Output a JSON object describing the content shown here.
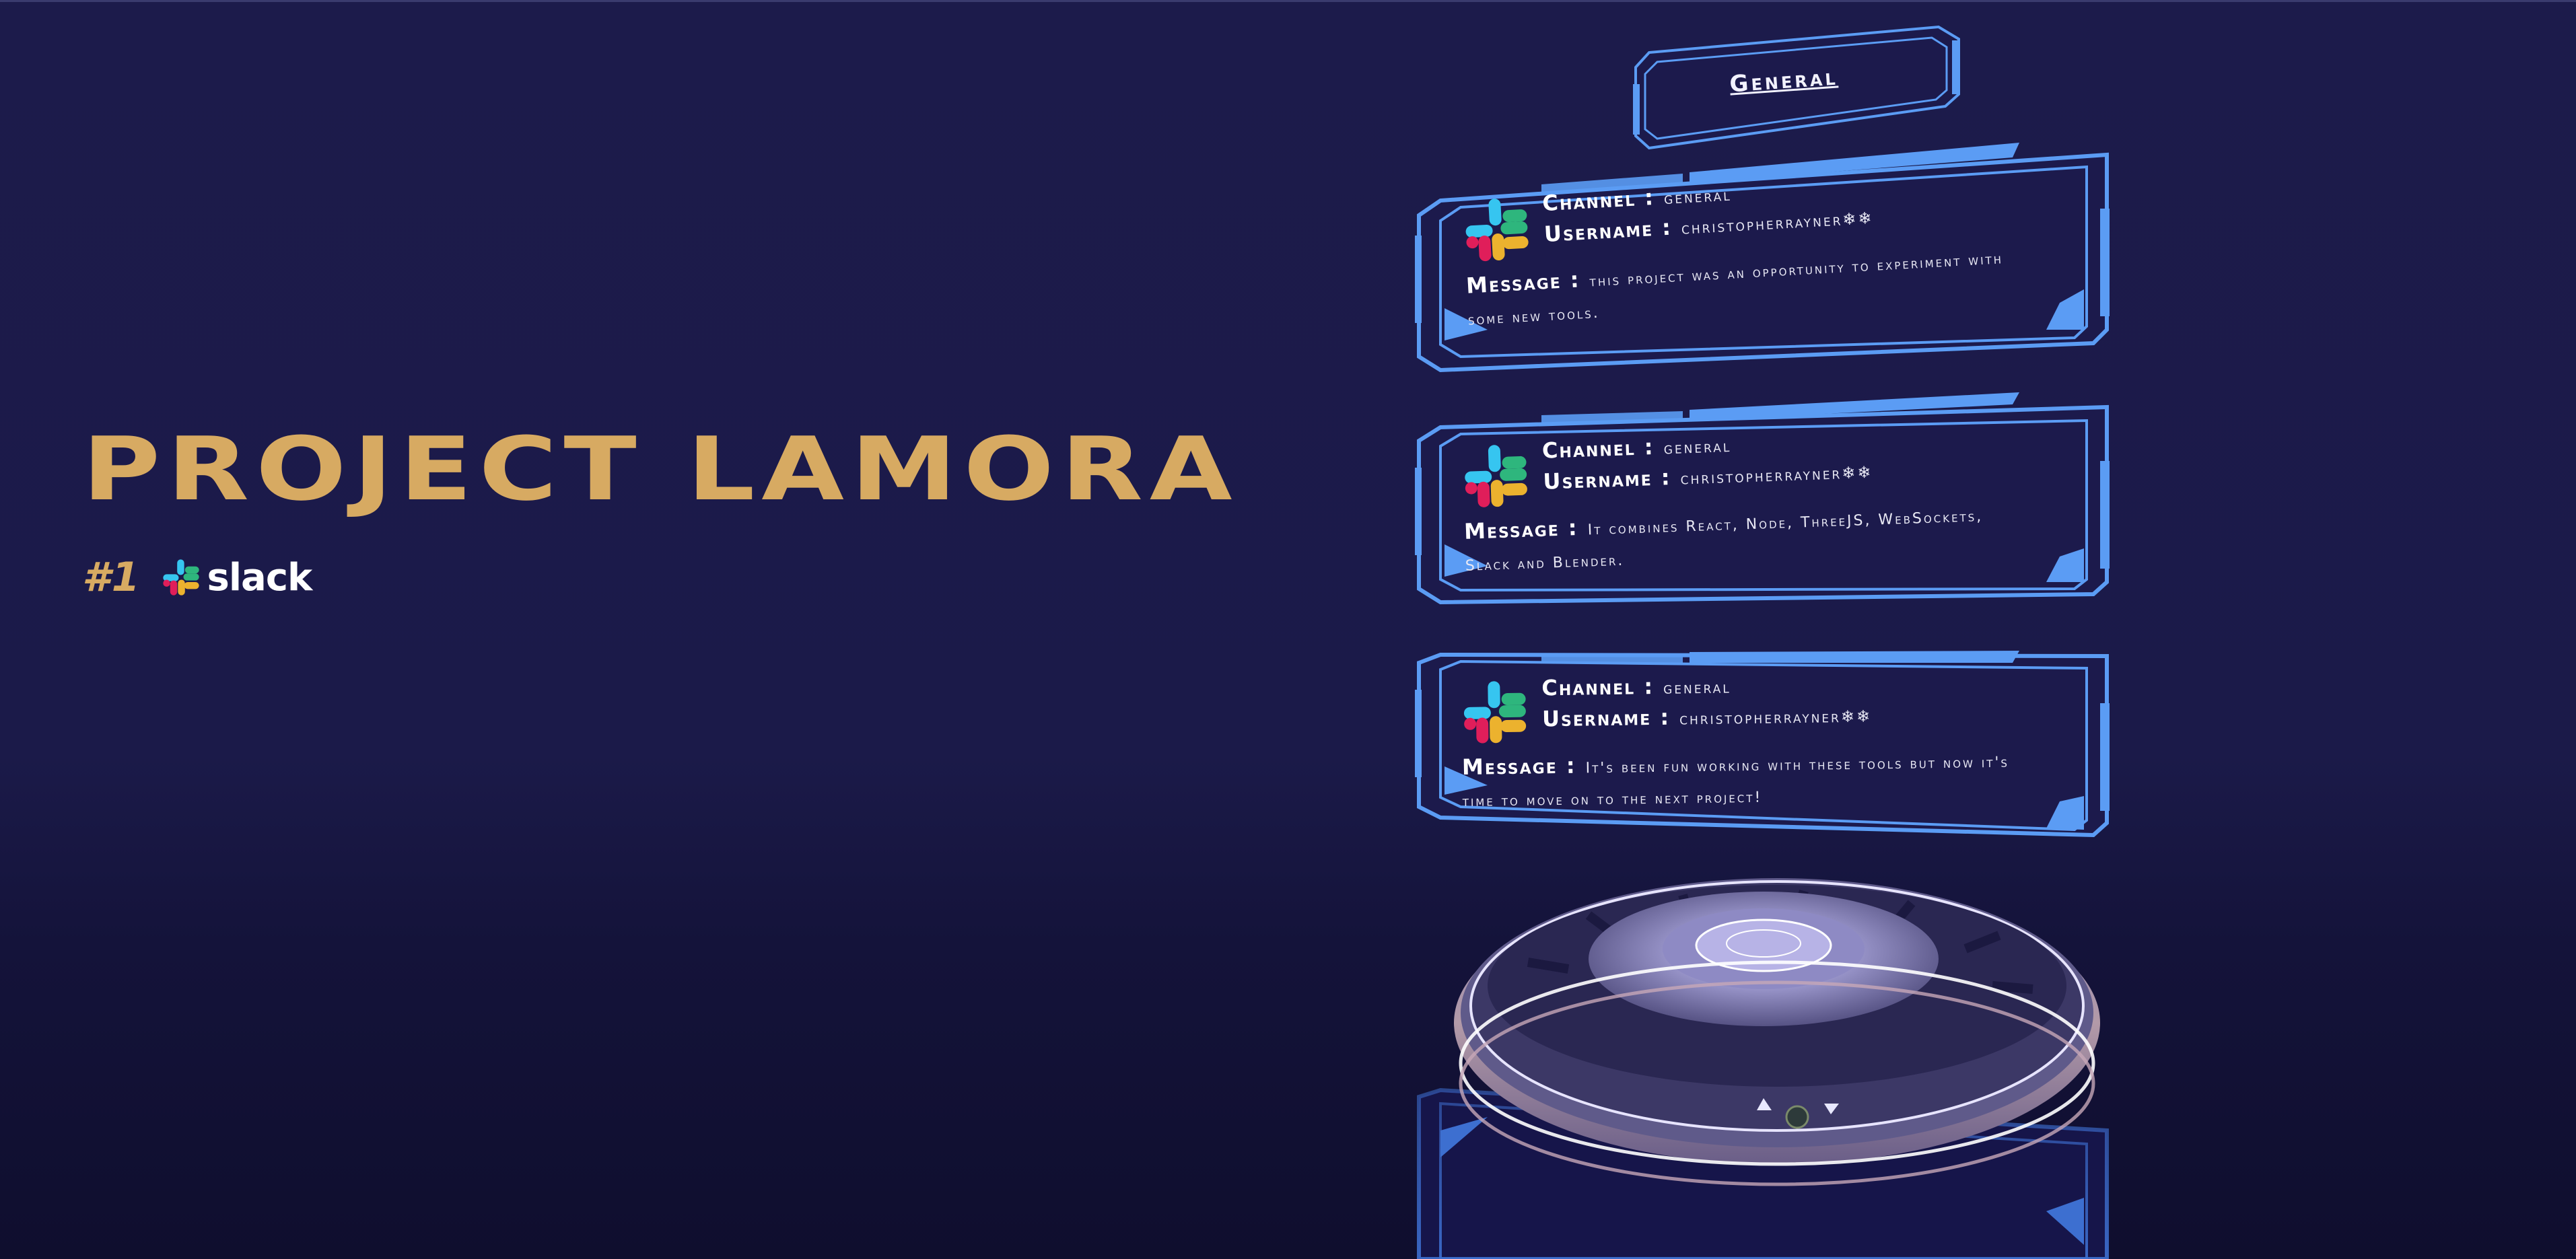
{
  "hero": {
    "title": "PROJECT LAMORA",
    "rank": "#1",
    "brand": "slack",
    "brand_icon": "slack-logo-icon"
  },
  "channel_tag": {
    "label": "General"
  },
  "messages": [
    {
      "channel_label": "Channel :",
      "channel_value": "general",
      "username_label": "Username :",
      "username_value": "christopherrayner❄❄",
      "message_label": "Message :",
      "message_value": "this project was an opportunity to experiment with some new tools."
    },
    {
      "channel_label": "Channel :",
      "channel_value": "general",
      "username_label": "Username :",
      "username_value": "christopherrayner❄❄",
      "message_label": "Message :",
      "message_value": "It combines React, Node, ThreeJS, WebSockets, Slack and Blender."
    },
    {
      "channel_label": "Channel :",
      "channel_value": "general",
      "username_label": "Username :",
      "username_value": "christopherrayner❄❄",
      "message_label": "Message :",
      "message_value": "It's been fun working with these tools but now it's time to move on to the next project!"
    }
  ],
  "colors": {
    "background": "#1b1a49",
    "title_gold": "#d7aa62",
    "hud_blue": "#5b9cf4",
    "hud_blue_dark": "#3d6fd0",
    "card_fill": "#1c1a4c",
    "text_white": "#ffffff"
  }
}
